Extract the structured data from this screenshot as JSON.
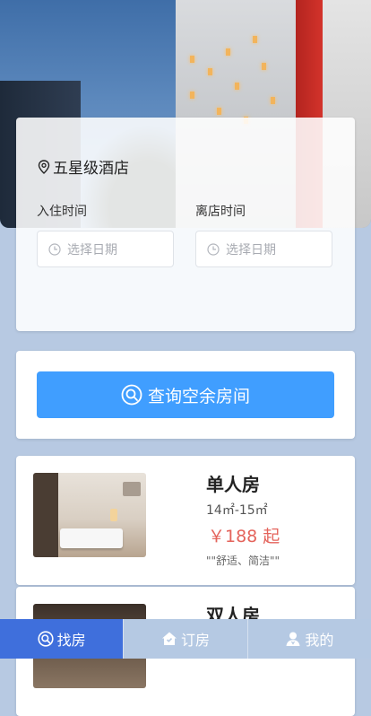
{
  "search": {
    "location": "五星级酒店",
    "checkin_label": "入住时间",
    "checkout_label": "离店时间",
    "checkin_placeholder": "选择日期",
    "checkout_placeholder": "选择日期",
    "query_button": "查询空余房间"
  },
  "rooms": [
    {
      "name": "单人房",
      "size": "14㎡-15㎡",
      "price": "￥188 起",
      "desc": "\"\"舒适、简洁\"\""
    },
    {
      "name": "双人房"
    }
  ],
  "tabbar": [
    {
      "label": "找房",
      "icon": "search-icon",
      "active": true
    },
    {
      "label": "订房",
      "icon": "home-icon",
      "active": false
    },
    {
      "label": "我的",
      "icon": "user-icon",
      "active": false
    }
  ],
  "colors": {
    "primary": "#409eff",
    "tab_active": "#3f6fdc",
    "price": "#e4635b"
  }
}
